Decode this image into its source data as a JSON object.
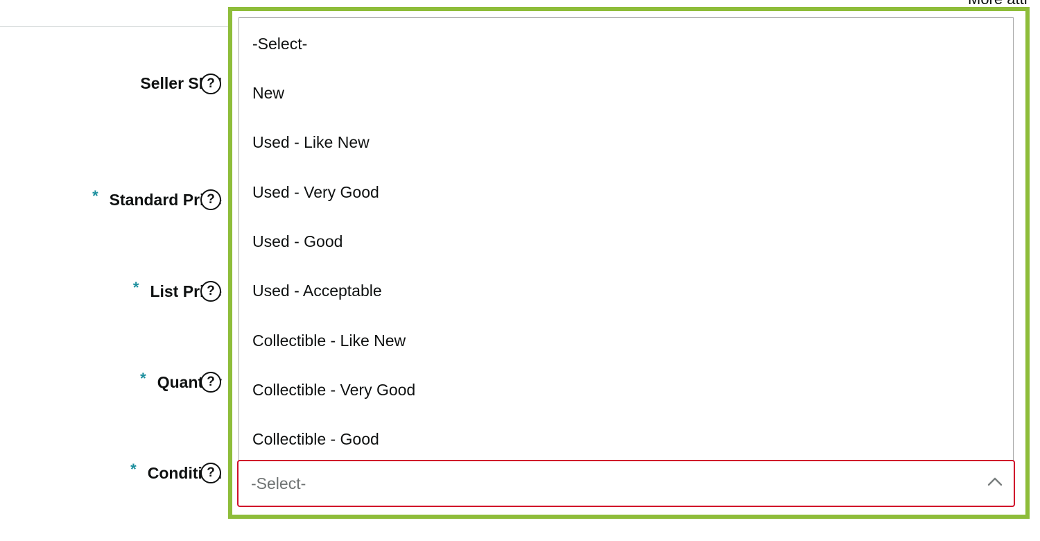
{
  "header": {
    "more_attributes_label": "More attr"
  },
  "form": {
    "fields": [
      {
        "label": "Seller SKU",
        "required": false,
        "help_icon": "question-circle-icon"
      },
      {
        "label": "Standard Price",
        "required": true,
        "help_icon": "question-circle-icon"
      },
      {
        "label": "List Price",
        "required": true,
        "help_icon": "question-circle-icon"
      },
      {
        "label": "Quantity",
        "required": true,
        "help_icon": "question-circle-icon"
      },
      {
        "label": "Condition",
        "required": true,
        "help_icon": "question-circle-icon"
      }
    ],
    "required_marker": "*",
    "help_glyph": "?"
  },
  "condition_dropdown": {
    "selected_value": "-Select-",
    "is_open": true,
    "has_error": true,
    "chevron_icon": "chevron-up-icon",
    "options": [
      "-Select-",
      "New",
      "Used - Like New",
      "Used - Very Good",
      "Used - Good",
      "Used - Acceptable",
      "Collectible - Like New",
      "Collectible - Very Good",
      "Collectible - Good"
    ]
  },
  "colors": {
    "highlight_frame": "#8ebd3a",
    "error_border": "#d00f2a",
    "required_marker": "#1c8f9e",
    "text": "#0f1111",
    "placeholder": "#6f7373"
  }
}
